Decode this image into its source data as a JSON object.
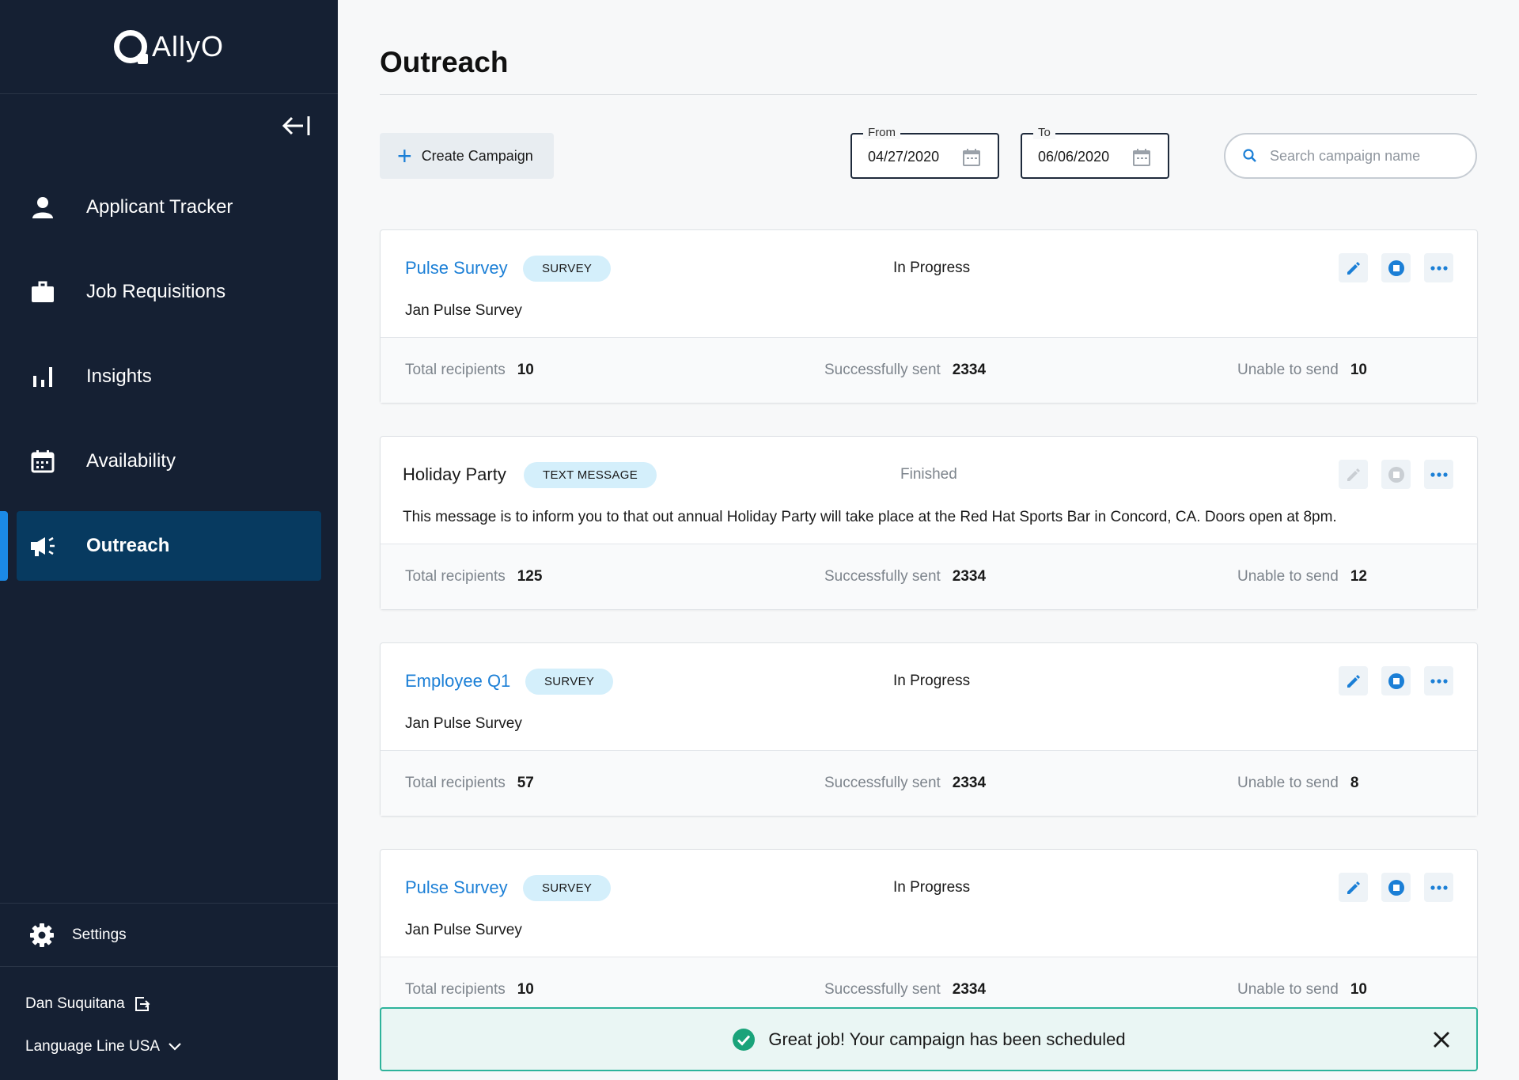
{
  "sidebar": {
    "logo_text": "AllyO",
    "nav": [
      {
        "label": "Applicant Tracker",
        "icon": "person-icon"
      },
      {
        "label": "Job Requisitions",
        "icon": "briefcase-icon"
      },
      {
        "label": "Insights",
        "icon": "bar-chart-icon"
      },
      {
        "label": "Availability",
        "icon": "calendar-icon"
      },
      {
        "label": "Outreach",
        "icon": "megaphone-icon",
        "active": true
      }
    ],
    "settings_label": "Settings",
    "user_name": "Dan Suquitana",
    "org_name": "Language Line USA"
  },
  "header": {
    "title": "Outreach",
    "create_label": "Create Campaign",
    "from_label": "From",
    "from_value": "04/27/2020",
    "to_label": "To",
    "to_value": "06/06/2020",
    "search_placeholder": "Search campaign name"
  },
  "campaigns": [
    {
      "name": "Pulse Survey",
      "type": "SURVEY",
      "status": "In Progress",
      "desc": "Jan Pulse Survey",
      "total_label": "Total recipients",
      "total": "10",
      "sent_label": "Successfully sent",
      "sent": "2334",
      "fail_label": "Unable to send",
      "fail": "10"
    },
    {
      "name": "Holiday Party",
      "type": "TEXT MESSAGE",
      "status": "Finished",
      "desc": "This message is to inform you to that out annual Holiday Party will take place at the Red Hat Sports Bar in Concord, CA. Doors open at 8pm.",
      "total_label": "Total recipients",
      "total": "125",
      "sent_label": "Successfully sent",
      "sent": "2334",
      "fail_label": "Unable to send",
      "fail": "12"
    },
    {
      "name": "Employee Q1",
      "type": "SURVEY",
      "status": "In Progress",
      "desc": "Jan Pulse Survey",
      "total_label": "Total recipients",
      "total": "57",
      "sent_label": "Successfully sent",
      "sent": "2334",
      "fail_label": "Unable to send",
      "fail": "8"
    },
    {
      "name": "Pulse Survey",
      "type": "SURVEY",
      "status": "In Progress",
      "desc": "Jan Pulse Survey",
      "total_label": "Total recipients",
      "total": "10",
      "sent_label": "Successfully sent",
      "sent": "2334",
      "fail_label": "Unable to send",
      "fail": "10"
    }
  ],
  "toast": {
    "message": "Great job! Your campaign has been scheduled"
  },
  "colors": {
    "sidebar": "#152033",
    "active_nav": "#073a60",
    "accent": "#1b7fd6",
    "success": "#1aa37a",
    "badge": "#d4effb"
  }
}
